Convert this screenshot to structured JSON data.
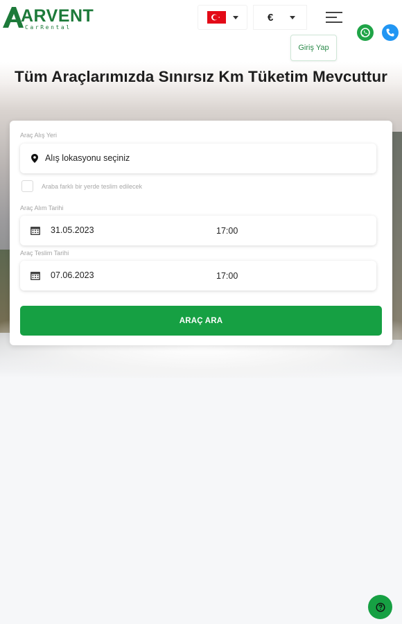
{
  "brand": {
    "name": "ARVENT",
    "tagline": "CarRental",
    "color": "#1d7a3a"
  },
  "header": {
    "language": {
      "selected": "Türkçe",
      "icon": "turkey-flag-icon"
    },
    "currency": {
      "selected": "€"
    },
    "menu_icon": "hamburger-menu-icon",
    "login_label": "Giriş Yap",
    "whatsapp_icon": "whatsapp-icon",
    "phone_icon": "phone-icon"
  },
  "hero": {
    "title": "Tüm Araçlarımızda Sınırsız Km Tüketim Mevcuttur"
  },
  "search": {
    "pickup_location_label": "Araç Alış Yeri",
    "pickup_location_value": "Alış lokasyonu seçiniz",
    "different_dropoff_label": "Araba farklı bir yerde teslim edilecek",
    "pickup_date_label": "Araç Alım Tarihi",
    "pickup_date": "31.05.2023",
    "pickup_time": "17:00",
    "return_date_label": "Araç Teslim Tarihi",
    "return_date": "07.06.2023",
    "return_time": "17:00",
    "submit_label": "ARAÇ ARA"
  },
  "colors": {
    "primary_green": "#16a043",
    "whatsapp_green": "#1fa447",
    "phone_blue": "#2196f3"
  },
  "help_icon": "help-icon"
}
